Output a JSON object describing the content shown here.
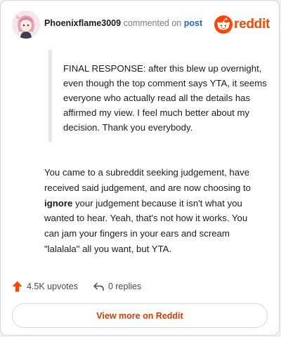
{
  "header": {
    "username": "Phoenixflame3009",
    "action": "commented on",
    "post_link": "post",
    "brand": "reddit",
    "avatar_icon": "anime-avatar-icon",
    "brand_icon": "reddit-snoo-icon",
    "brand_color": "#ff4500"
  },
  "quote": {
    "text": "FINAL RESPONSE: after this blew up overnight, even though the top comment says YTA, it seems everyone who actually read all the details has affirmed my view. I feel much better about my decision. Thank you everybody."
  },
  "comment": {
    "before": "You came to a subreddit seeking judgement, have received said judgement, and are now choosing to ",
    "emphasis": "ignore",
    "after": " your judgement because it isn't what you wanted to hear. Yeah, that's not how it works. You can jam your fingers in your ears and scream \"lalalala\" all you want, but YTA."
  },
  "actions": {
    "upvotes": "4.5K upvotes",
    "replies": "0 replies",
    "upvote_icon": "upvote-arrow-icon",
    "reply_icon": "reply-arrow-icon"
  },
  "footer": {
    "view_more": "View more on Reddit"
  }
}
